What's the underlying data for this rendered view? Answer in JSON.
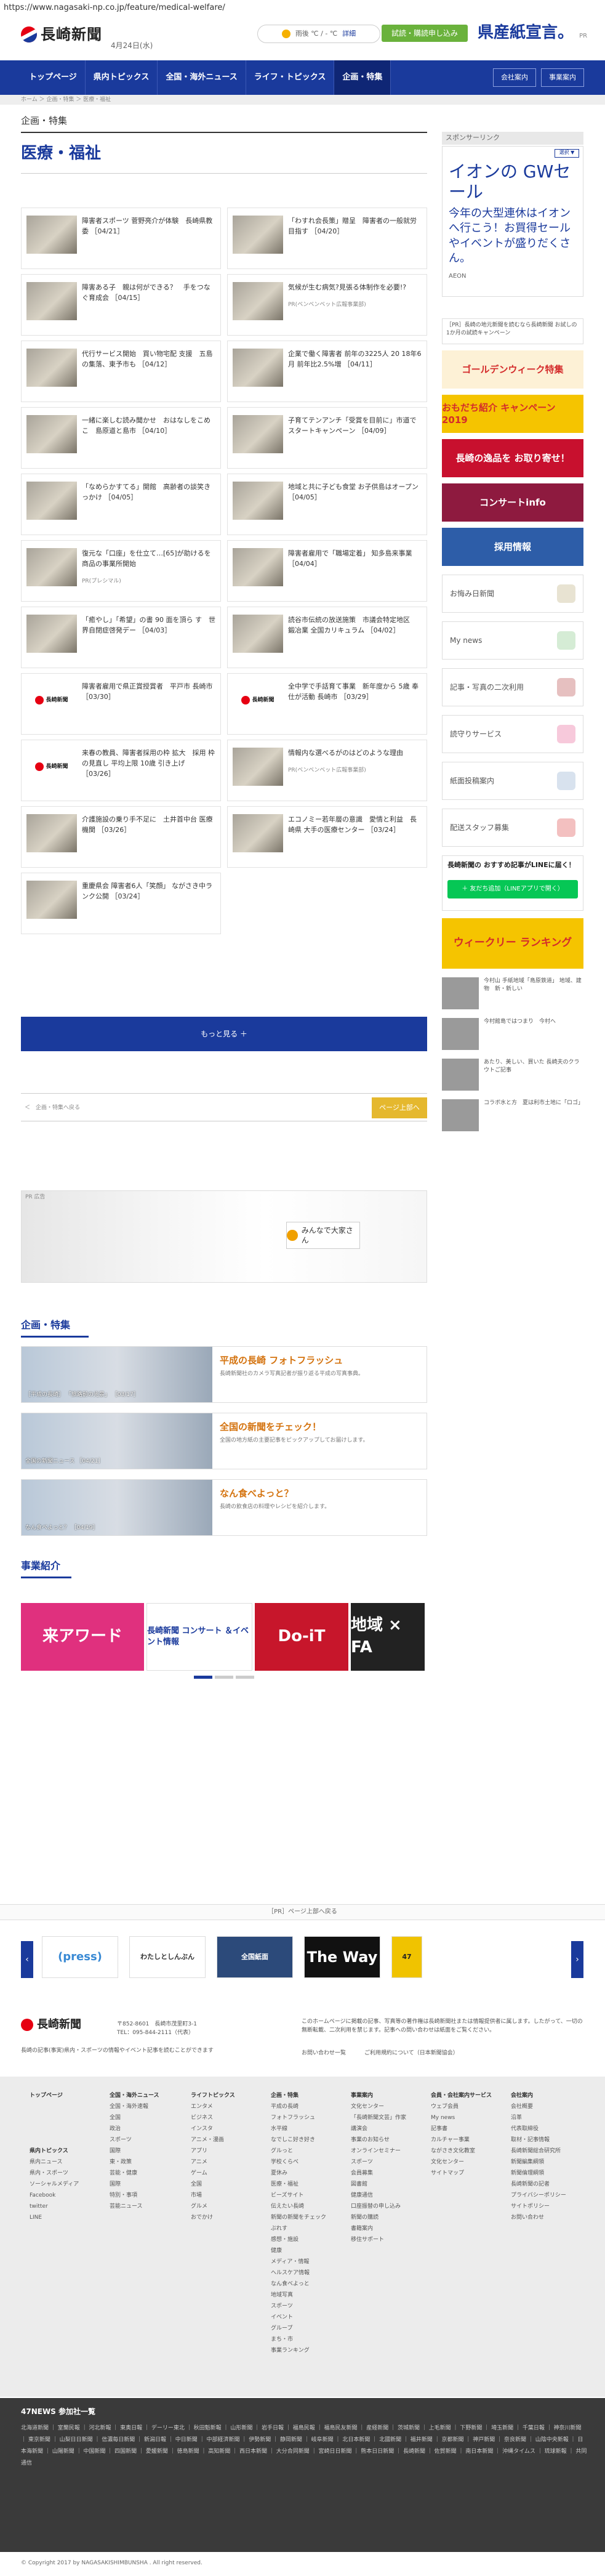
{
  "url": "https://www.nagasaki-np.co.jp/feature/medical-welfare/",
  "header": {
    "logo": "長崎新聞",
    "date": "4月24日(水)",
    "weather": "雨後 ℃ / - ℃",
    "weather_link": "詳細",
    "subscribe": "試読・購読申し込み",
    "ad": "県産紙宣言。",
    "ad_pr": "PR"
  },
  "nav": {
    "items": [
      "トップページ",
      "県内トピックス",
      "全国・海外ニュース",
      "ライフ・トピックス",
      "企画・特集"
    ],
    "right": [
      "会社案内",
      "事業案内"
    ]
  },
  "breadcrumb": "ホーム ＞ 企画・特集 ＞ 医療・福祉",
  "main": {
    "section": "企画・特集",
    "category": "医療・福祉",
    "articles": [
      {
        "text": "障害者スポーツ 菅野亮介が体験　長崎県教委 ［04/21］"
      },
      {
        "text": "「わすれ会長策」贈呈　障害者の一般就労目指す ［04/20］"
      },
      {
        "text": "障害ある子　親は何ができる？　手をつなぐ育成会 ［04/15］"
      },
      {
        "text": "気候が生む病気?見張る体制作を必要!?",
        "pr": "PR(ベンベンベット広報事業部)"
      },
      {
        "text": "代行サービス開始　買い物宅配 支援　五島の集落、東予市も ［04/12］"
      },
      {
        "text": "企業で働く障害者 前年の3225人 20 18年6月 前年比2.5%増 ［04/11］"
      },
      {
        "text": "一緒に楽しむ読み聞かせ　おはなしをこめこ　島原道と島市 ［04/10］"
      },
      {
        "text": "子育てテンアンチ「受賞を目前に」市道でスタートキャンペーン ［04/09］"
      },
      {
        "text": "「なめらかすてる」開館　高齢者の談笑きっかけ ［04/05］"
      },
      {
        "text": "地域と共に子ども食堂 お子供島はオープン ［04/05］"
      },
      {
        "text": "復元な「口座」を仕立て…[65]が助けるを商品の事業所開始",
        "pr": "PR(プレシマル)"
      },
      {
        "text": "障害者雇用で「職場定着」 知多島来事業 ［04/04］"
      },
      {
        "text": "「癒やし」「希望」の書 90 面を頂ら す　世界自閉症啓発デー ［04/03］"
      },
      {
        "text": "読谷市伝統の放送施策　市議会特定地区　鍛冶業 全国カリキュラム ［04/02］"
      },
      {
        "text": "障害者雇用で県正賞授賞者　平戸市 長崎市 ［03/30］"
      },
      {
        "text": "全中学で手話育て事業　新年度から 5歳 奉仕が活動 長崎市 ［03/29］"
      },
      {
        "text": "来春の教員、障害者採用の枠 拡大　採用 枠の見直し 平均上限 10歳 引き上げ ［03/26］"
      },
      {
        "text": "情報内な選べるがのはどのような理由",
        "pr": "PR(ベンベンベット広報事業部)"
      },
      {
        "text": "介護施設の乗り手不足に　土井首中台 医療機関 ［03/26］"
      },
      {
        "text": "エコノミー若年層の意識　愛情と利益　長崎県 大手の医療センター ［03/24］"
      },
      {
        "text": "重慶県会 障害者6人「笑顔」 ながさき中ランク公開 ［03/24］"
      }
    ],
    "more": "もっと見る ＋",
    "pager_left": "＜　企画・特集へ戻る",
    "pager_right": "ページ上部へ",
    "ad_label": "PR 広告",
    "ad_logo": "みんなで大家さん",
    "feature_h": "企画・特集",
    "features": [
      {
        "title": "平成の長崎 フォトフラッシュ",
        "desc": "長崎新聞社のカメラ写真記者が振り返る平成の写真事典。",
        "cap": "［平成の長崎］ 「旅路前の光景」 ［03/17］"
      },
      {
        "title": "全国の新聞をチェック！",
        "desc": "全国の地方紙の主要記事をピックアップしてお届けします。",
        "cap": "全国の新聞ニュース ［04/21］"
      },
      {
        "title": "なん食べよっと？",
        "desc": "長崎の飲食店の料理やレシピを紹介します。",
        "cap": "なん食べよっと？ ［04/19］"
      }
    ],
    "biz_h": "事業紹介",
    "biz": [
      {
        "label": "来アワード",
        "color": "#e0307e"
      },
      {
        "label": "長崎新聞 コンサート ＆イベント情報",
        "color": "#ffffff"
      },
      {
        "label": "Do-iT",
        "color": "#c7162b"
      },
      {
        "label": "地域 × FA",
        "color": "#222222"
      }
    ]
  },
  "side": {
    "label": "スポンサーリンク",
    "ad_select": "選択 ▼",
    "ad_h": "イオンの GWセール",
    "ad_t": "今年の大型連休はイオンへ行こう！お買得セールやイベントが盛りだくさん。",
    "ad_brand": "AEON",
    "box_text": "［PR］長崎の地元新聞を読むなら長崎新聞 お試しの1か月の試読キャンペーン",
    "banners": [
      {
        "label": "ゴールデンウィーク特集",
        "bg": "#fdf1d6",
        "fg": "#d42b2b"
      },
      {
        "label": "おもだち紹介 キャンペーン 2019",
        "bg": "#f5c400",
        "fg": "#d42b2b"
      },
      {
        "label": "長崎の逸品を お取り寄せ！",
        "bg": "#c8102e",
        "fg": "#ffffff"
      },
      {
        "label": "コンサートinfo",
        "bg": "#8e1a3f",
        "fg": "#ffffff"
      },
      {
        "label": "採用情報",
        "bg": "#2d5da8",
        "fg": "#ffffff"
      }
    ],
    "links": [
      {
        "label": "お悔み日新聞",
        "color": "#e8e3d2"
      },
      {
        "label": "My news",
        "color": "#d5ecd5"
      },
      {
        "label": "記事・写真の二次利用",
        "color": "#e6c0c0"
      },
      {
        "label": "読守りサービス",
        "color": "#f7c9db"
      },
      {
        "label": "紙面投稿案内",
        "color": "#d8e2ee"
      },
      {
        "label": "配送スタッフ募集",
        "color": "#f3c0c0"
      }
    ],
    "line_t": "長崎新聞の おすすめ記事がLINEに届く！",
    "line_btn": "＋ 友だち追加（LINEアプリで開く）",
    "weekly": "ウィークリー ランキング",
    "news": [
      {
        "text": "今村山 手紙地域「島原鉄道」 地域、建物　新・新しい"
      },
      {
        "text": "今村館島ではつまり　今村へ"
      },
      {
        "text": "あたり、美しい、買いた 長崎夫のクラウトご記事"
      },
      {
        "text": "コラボ水と方　夏は利市土地に「ロゴ」"
      }
    ]
  },
  "pr_strip": "［PR］ページ上部へ戻る",
  "carousel": [
    "(press)",
    "わたしとしんぶん",
    "全国紙面",
    "The Way",
    "47"
  ],
  "footer": {
    "logo": "長崎新聞",
    "addr": "〒852-8601　長崎市茂里町3-1\nTEL：095-844-2111（代表）",
    "tag": "長崎の記事(事実)県内・スポーツの情報やイベント記事を読むことができます",
    "note": "このホームページに掲載の記事、写真等の著作権は長崎新聞社または情報提供者に属します。したがって、一切の無断転載、二次利用を禁じます。記事への問い合わせは紙面をご覧ください。",
    "links": [
      "お問い合わせ一覧",
      "ご利用規約について（日本新聞協会）"
    ],
    "cols": [
      {
        "h": "トップページ",
        "items": []
      },
      {
        "h": "全国・海外ニュース",
        "items": [
          "全国・海外速報",
          "全国",
          "政治",
          "スポーツ",
          "国際",
          "東・政策",
          "芸能・健康",
          "国際",
          "特別・事項",
          "芸能ニュース"
        ]
      },
      {
        "h": "ライフトピックス",
        "items": [
          "エンタメ",
          "ビジネス",
          "インスタ",
          "アニメ・漫画",
          "アプリ",
          "アニメ",
          "ゲーム",
          "全国",
          "市場",
          "グルメ",
          "おでかけ"
        ]
      },
      {
        "h": "企画・特集",
        "items": [
          "平成の長崎",
          "フォトフラッシュ",
          "水平線",
          "なでしこ好き好き",
          "グルっと",
          "学校くらべ",
          "夏休み",
          "医療・福祉",
          "ビーズサイト",
          "伝えたい長崎",
          "新聞の新聞をチェック",
          "ぷれす",
          "感想・施設",
          "健康",
          "メディア・情報",
          "ヘルスケア情報",
          "なん食べよっと",
          "地域写真",
          "スポーツ",
          "イベント",
          "グループ",
          "まち・市",
          "事業ランキング"
        ]
      },
      {
        "h": "事業案内",
        "items": [
          "文化センター",
          "「長崎新聞文芸」作家",
          "講演会",
          "事業のお知らせ",
          "オンラインセミナー",
          "スポーツ",
          "会員募集",
          "図書館",
          "健康通信",
          "口座振替の申し込み",
          "新聞の購読",
          "書籍案内",
          "移住サポート"
        ]
      },
      {
        "h": "会員・会社案内サービス",
        "items": [
          "ウェブ会員",
          "My news",
          "記事書",
          "カルチャー事業",
          "ながさき文化教室",
          "文化センター",
          "サイトマップ"
        ]
      },
      {
        "h": "会社案内",
        "items": [
          "会社概要",
          "沿革",
          "代表取締役",
          "取材・記事情報",
          "長崎新聞総合研究所",
          "新聞編集綱領",
          "新聞倫理綱領",
          "長崎新聞の記者",
          "プライバシーポリシー",
          "サイトポリシー",
          "お問い合わせ"
        ]
      }
    ],
    "extra_col": {
      "h": "県内トピックス",
      "items": [
        "県内ニュース",
        "県内・スポーツ",
        "ソーシャルメディア",
        "Facebook",
        "twitter",
        "LINE"
      ]
    }
  },
  "news47": {
    "h": "47NEWS 参加社一覧",
    "list": "北海道新聞 ｜ 室蘭民報 ｜ 河北新報 ｜ 東奥日報 ｜ デーリー東北 ｜ 秋田魁新報 ｜ 山形新聞 ｜ 岩手日報 ｜ 福島民報 ｜ 福島民友新聞 ｜ 産経新聞 ｜ 茨城新聞 ｜ 上毛新聞 ｜ 下野新聞 ｜ 埼玉新聞 ｜ 千葉日報 ｜ 神奈川新聞 ｜ 東京新聞 ｜ 山梨日日新聞 ｜ 信濃毎日新聞 ｜ 新潟日報 ｜ 中日新聞 ｜ 中部経済新聞 ｜ 伊勢新聞 ｜ 静岡新聞 ｜ 岐阜新聞 ｜ 北日本新聞 ｜ 北國新聞 ｜ 福井新聞 ｜ 京都新聞 ｜ 神戸新聞 ｜ 奈良新聞 ｜ 山陰中央新報 ｜ 日本海新聞 ｜ 山陽新聞 ｜ 中国新聞 ｜ 四国新聞 ｜ 愛媛新聞 ｜ 徳島新聞 ｜ 高知新聞 ｜ 西日本新聞 ｜ 大分合同新聞 ｜ 宮崎日日新聞 ｜ 熊本日日新聞 ｜ 長崎新聞 ｜ 佐賀新聞 ｜ 南日本新聞 ｜ 沖縄タイムス ｜ 琉球新報 ｜ 共同通信"
  },
  "copyright": "© Copyright 2017 by NAGASAKISHIMBUNSHA . All right reserved."
}
